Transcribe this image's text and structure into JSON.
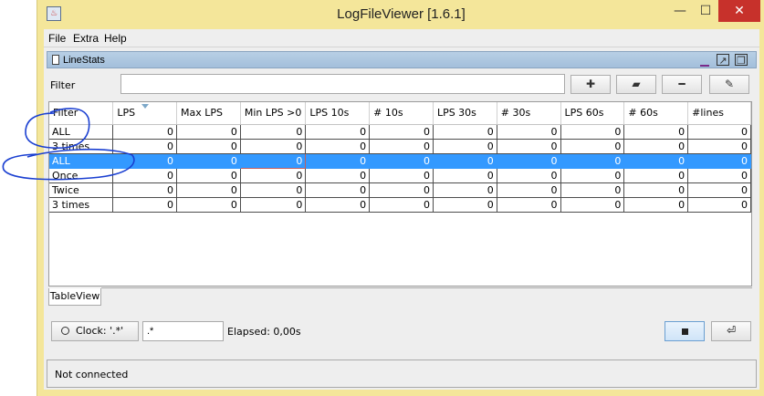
{
  "window": {
    "title": "LogFileViewer [1.6.1]",
    "controls": {
      "minimize": "—",
      "maximize": "☐",
      "close": "✕"
    }
  },
  "menu": [
    "File",
    "Extra",
    "Help"
  ],
  "panel": {
    "title": "LineStats",
    "filter_label": "Filter",
    "filter_value": "",
    "toolbar_icons": [
      "plus-icon",
      "folder-icon",
      "minus-icon",
      "edit-icon"
    ]
  },
  "table": {
    "columns": [
      "Filter",
      "LPS",
      "Max LPS",
      "Min LPS >0",
      "LPS 10s",
      "# 10s",
      "LPS 30s",
      "# 30s",
      "LPS 60s",
      "# 60s",
      "#lines"
    ],
    "rows": [
      [
        "ALL",
        "0",
        "0",
        "0",
        "0",
        "0",
        "0",
        "0",
        "0",
        "0",
        "0"
      ],
      [
        "3 times",
        "0",
        "0",
        "0",
        "0",
        "0",
        "0",
        "0",
        "0",
        "0",
        "0"
      ],
      [
        "ALL",
        "0",
        "0",
        "0",
        "0",
        "0",
        "0",
        "0",
        "0",
        "0",
        "0"
      ],
      [
        "Once",
        "0",
        "0",
        "0",
        "0",
        "0",
        "0",
        "0",
        "0",
        "0",
        "0"
      ],
      [
        "Twice",
        "0",
        "0",
        "0",
        "0",
        "0",
        "0",
        "0",
        "0",
        "0",
        "0"
      ],
      [
        "3 times",
        "0",
        "0",
        "0",
        "0",
        "0",
        "0",
        "0",
        "0",
        "0",
        "0"
      ]
    ],
    "selected_row": 2
  },
  "tabs": [
    "TableView"
  ],
  "bottom": {
    "clock_label": "Clock: '.*'",
    "pattern_value": ".*",
    "elapsed": "Elapsed: 0,00s"
  },
  "status": "Not connected",
  "colors": {
    "titlebar": "#f4e69a",
    "selection": "#3399ff",
    "close": "#c7312b",
    "annotation": "#1a3fd1"
  }
}
